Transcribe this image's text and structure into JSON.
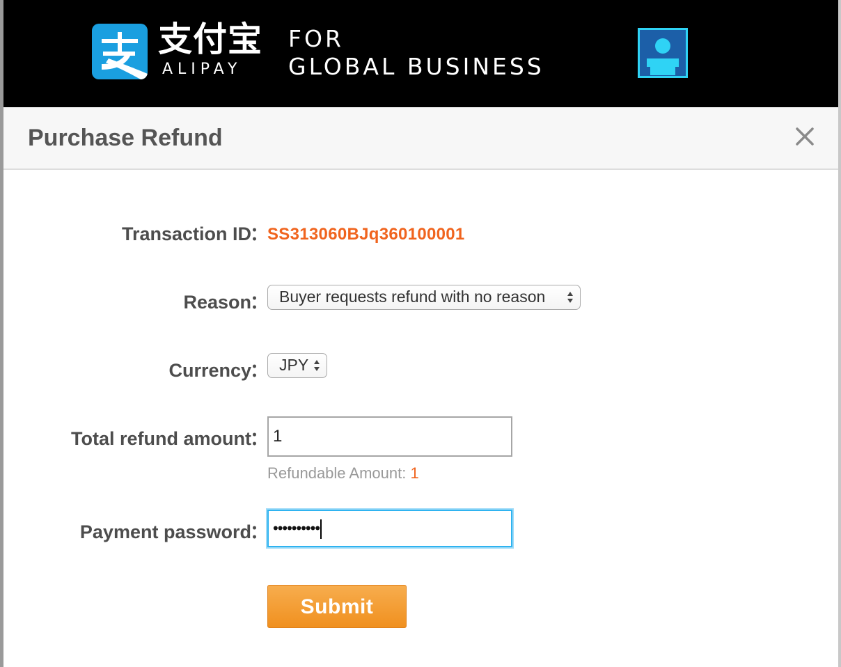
{
  "header": {
    "logo_cn": "支付宝",
    "logo_en": "ALIPAY",
    "tagline_line1": "FOR",
    "tagline_line2": "GLOBAL BUSINESS",
    "logo_icon": "alipay-zhi-icon",
    "account_icon": "user-account-icon",
    "brand_color": "#1a9fe0"
  },
  "dialog": {
    "title": "Purchase Refund",
    "close_icon": "close-icon"
  },
  "form": {
    "transaction_label": "Transaction ID",
    "transaction_id": "SS313060BJq360100001",
    "reason_label": "Reason",
    "reason_value": "Buyer requests refund with no reason",
    "currency_label": "Currency",
    "currency_value": "JPY",
    "amount_label": "Total refund amount",
    "amount_value": "1",
    "refundable_label": "Refundable Amount:",
    "refundable_value": "1",
    "password_label": "Payment password",
    "password_value": "••••••••••",
    "colon": "：",
    "submit_label": "Submit"
  },
  "colors": {
    "accent_orange": "#f0641e",
    "button_orange": "#f0901f",
    "focus_blue": "#2fb3f0"
  }
}
